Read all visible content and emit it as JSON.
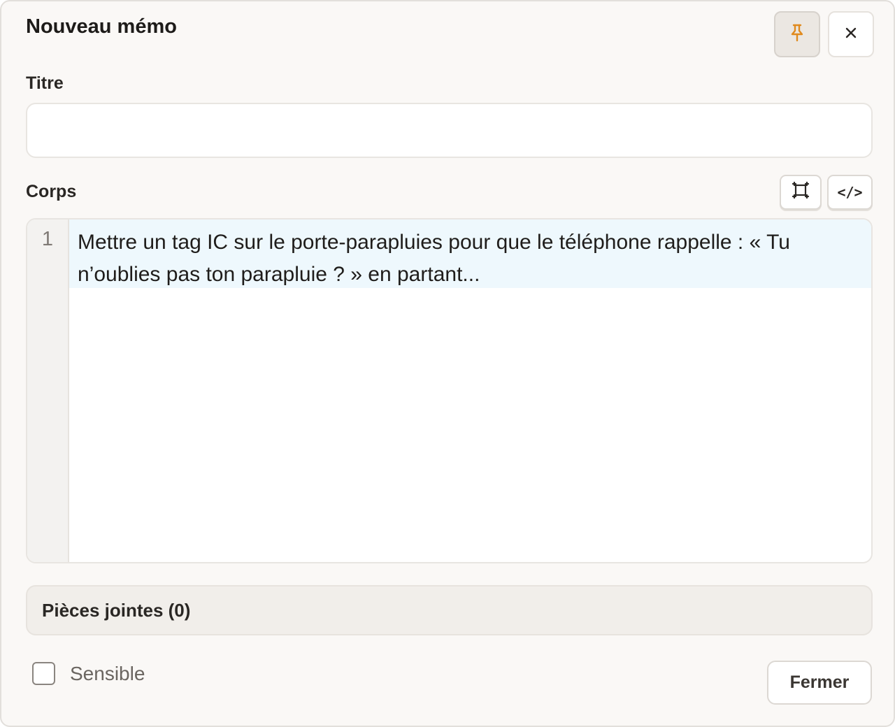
{
  "dialog": {
    "title": "Nouveau mémo",
    "pin_icon": "pin-icon",
    "close_icon": "close-icon",
    "accent_color": "#e08a1e"
  },
  "title_field": {
    "label": "Titre",
    "value": "",
    "placeholder": ""
  },
  "body_field": {
    "label": "Corps",
    "expand_icon": "expand-icon",
    "code_label": "</>",
    "lines": [
      {
        "number": "1",
        "text": "Mettre un tag IC sur le porte-parapluies pour que le téléphone rappelle : « Tu n’oublies pas ton parapluie ? » en partant..."
      }
    ]
  },
  "attachments": {
    "label": "Pièces jointes (0)"
  },
  "footer": {
    "sensitive_label": "Sensible",
    "sensitive_checked": false,
    "close_label": "Fermer"
  }
}
